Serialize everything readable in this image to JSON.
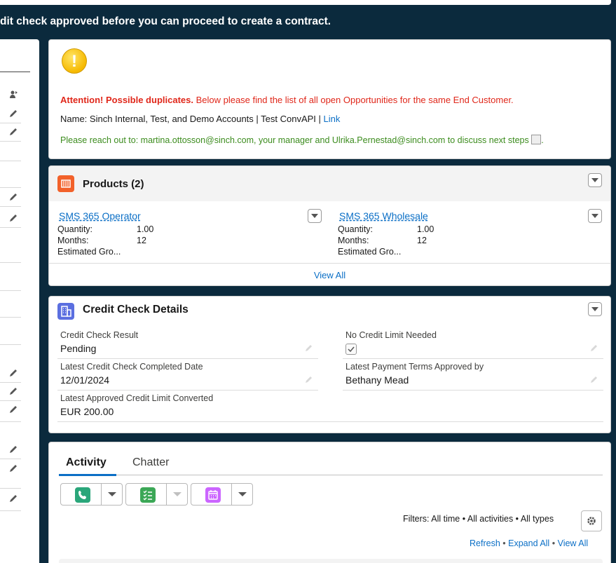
{
  "banner": {
    "text": "dit check approved before you can proceed to create a contract."
  },
  "duplicates": {
    "attention_label": "Attention! Possible duplicates.",
    "attention_text": " Below please find the list of all open Opportunities for the same End Customer.",
    "name_text": "Name: Sinch Internal, Test, and Demo Accounts | Test ConvAPI | ",
    "link_label": "Link",
    "reach_out": "Please reach out to: martina.ottosson@sinch.com, your manager and Ulrika.Pernestad@sinch.com to discuss next steps",
    "reach_out_tail": "."
  },
  "products": {
    "title": "Products (2)",
    "items": [
      {
        "name": "SMS 365 Operator",
        "quantity_label": "Quantity:",
        "quantity": "1.00",
        "months_label": "Months:",
        "months": "12",
        "est_label": "Estimated Gro..."
      },
      {
        "name": "SMS 365 Wholesale",
        "quantity_label": "Quantity:",
        "quantity": "1.00",
        "months_label": "Months:",
        "months": "12",
        "est_label": "Estimated Gro..."
      }
    ],
    "view_all": "View All"
  },
  "credit": {
    "title": "Credit Check Details",
    "fields": [
      {
        "label": "Credit Check Result",
        "value": "Pending"
      },
      {
        "label": "No Credit Limit Needed",
        "value": ""
      },
      {
        "label": "Latest Credit Check Completed Date",
        "value": "12/01/2024"
      },
      {
        "label": "Latest Payment Terms Approved by",
        "value": "Bethany Mead"
      },
      {
        "label": "Latest Approved Credit Limit Converted",
        "value": "EUR 200.00"
      }
    ]
  },
  "activity": {
    "tabs": [
      "Activity",
      "Chatter"
    ],
    "filters": "Filters: All time • All activities • All types",
    "links": [
      "Refresh",
      "Expand All",
      "View All"
    ],
    "sep": "•"
  },
  "colors": {
    "background": "#0b2a3d",
    "link": "#0b6fc6",
    "attention": "#e0271a",
    "reach_out": "#3c8c1e"
  }
}
